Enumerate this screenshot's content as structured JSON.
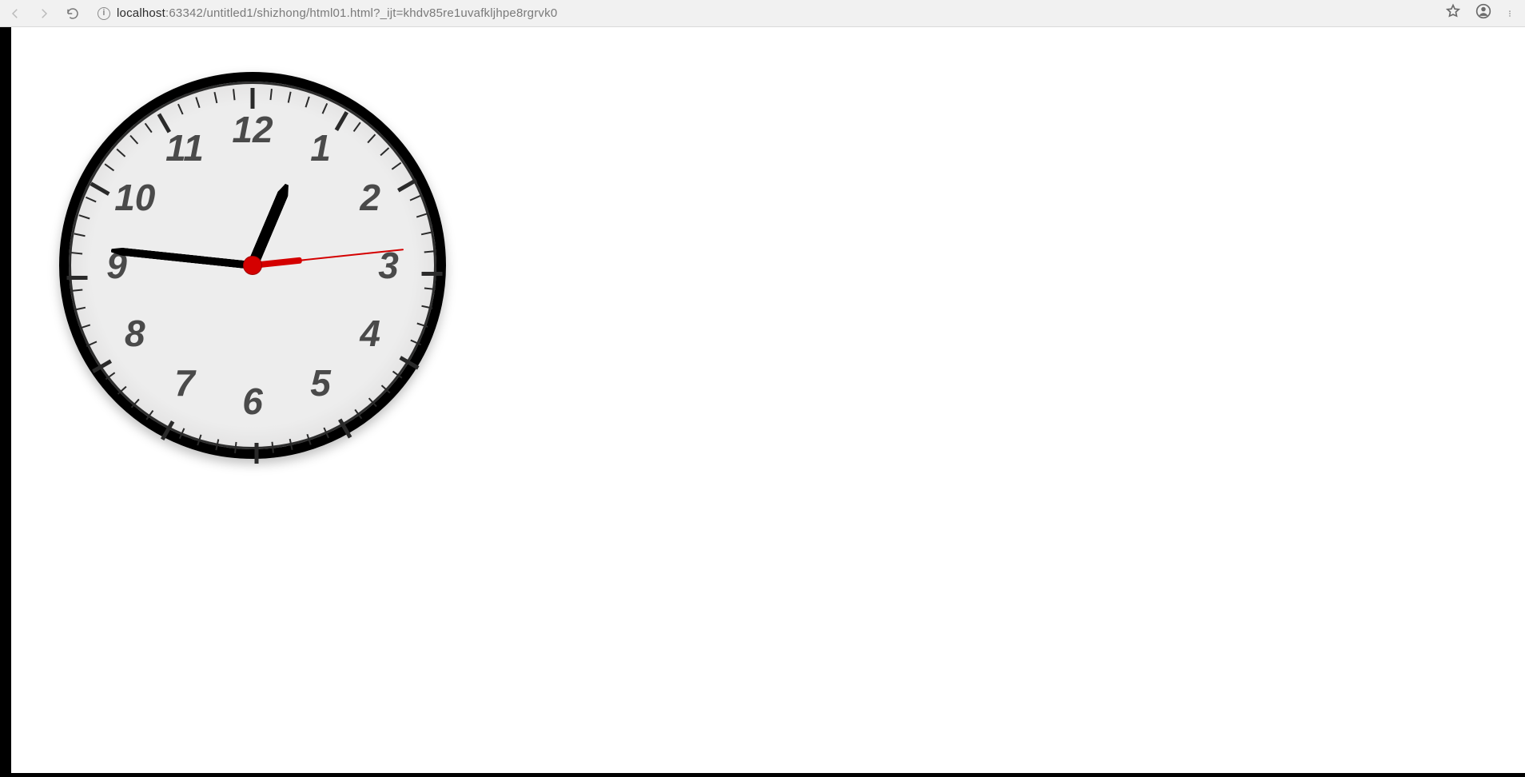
{
  "browser": {
    "url_host": "localhost",
    "url_path": ":63342/untitled1/shizhong/html01.html?_ijt=khdv85re1uvafkljhpe8rgrvk0",
    "info_icon": "info-icon",
    "back_icon": "back-arrow-icon",
    "forward_icon": "forward-arrow-icon",
    "reload_icon": "reload-icon",
    "star_icon": "bookmark-star-icon",
    "profile_icon": "profile-icon",
    "menu_icon": "kebab-menu-icon"
  },
  "clock": {
    "numerals": [
      "12",
      "1",
      "2",
      "3",
      "4",
      "5",
      "6",
      "7",
      "8",
      "9",
      "10",
      "11"
    ],
    "time": {
      "hours": 12,
      "minutes": 46,
      "seconds": 14
    },
    "hand_angles": {
      "hour": 23,
      "minute": 276,
      "second": 84,
      "second_tail": 264
    },
    "face_radius_px": 230,
    "numeral_radius_px": 170,
    "tick_outer_radius_px": 222,
    "colors": {
      "rim": "#000000",
      "face": "#ededed",
      "hand": "#000000",
      "second": "#d40000",
      "numeral": "#4a4a4a"
    }
  }
}
